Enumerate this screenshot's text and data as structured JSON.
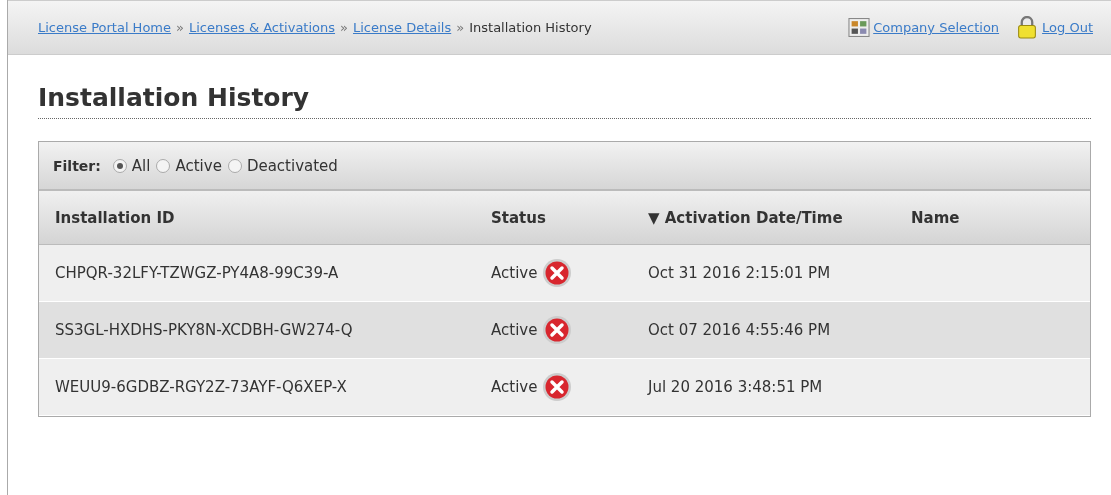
{
  "breadcrumbs": [
    {
      "label": "License Portal Home",
      "link": true
    },
    {
      "label": "Licenses & Activations",
      "link": true
    },
    {
      "label": "License Details",
      "link": true
    },
    {
      "label": "Installation History",
      "link": false
    }
  ],
  "breadcrumb_separator": "»",
  "header_links": [
    {
      "label": "Company Selection",
      "kind": "grid"
    },
    {
      "label": "Log Out",
      "kind": "lock"
    }
  ],
  "title": "Installation History",
  "filter": {
    "label": "Filter:",
    "options": [
      {
        "label": "All",
        "selected": true
      },
      {
        "label": "Active",
        "selected": false
      },
      {
        "label": "Deactivated",
        "selected": false
      }
    ]
  },
  "table": {
    "columns": [
      {
        "label": "Installation ID"
      },
      {
        "label": "Status"
      },
      {
        "label": "Activation Date/Time",
        "sort": "▼"
      },
      {
        "label": "Name"
      }
    ],
    "rows": [
      {
        "id": "CHPQR-32LFY-TZWGZ-PY4A8-99C39-A",
        "status": "Active",
        "date": "Oct 31 2016 2:15:01 PM"
      },
      {
        "id": "SS3GL-HXDHS-PKY8N-XCDBH-GW274-Q",
        "status": "Active",
        "date": "Oct 07 2016 4:55:46 PM"
      },
      {
        "id": "WEUU9-6GDBZ-RGY2Z-73AYF-Q6XEP-X",
        "status": "Active",
        "date": "Jul 20 2016 3:48:51 PM"
      }
    ]
  }
}
